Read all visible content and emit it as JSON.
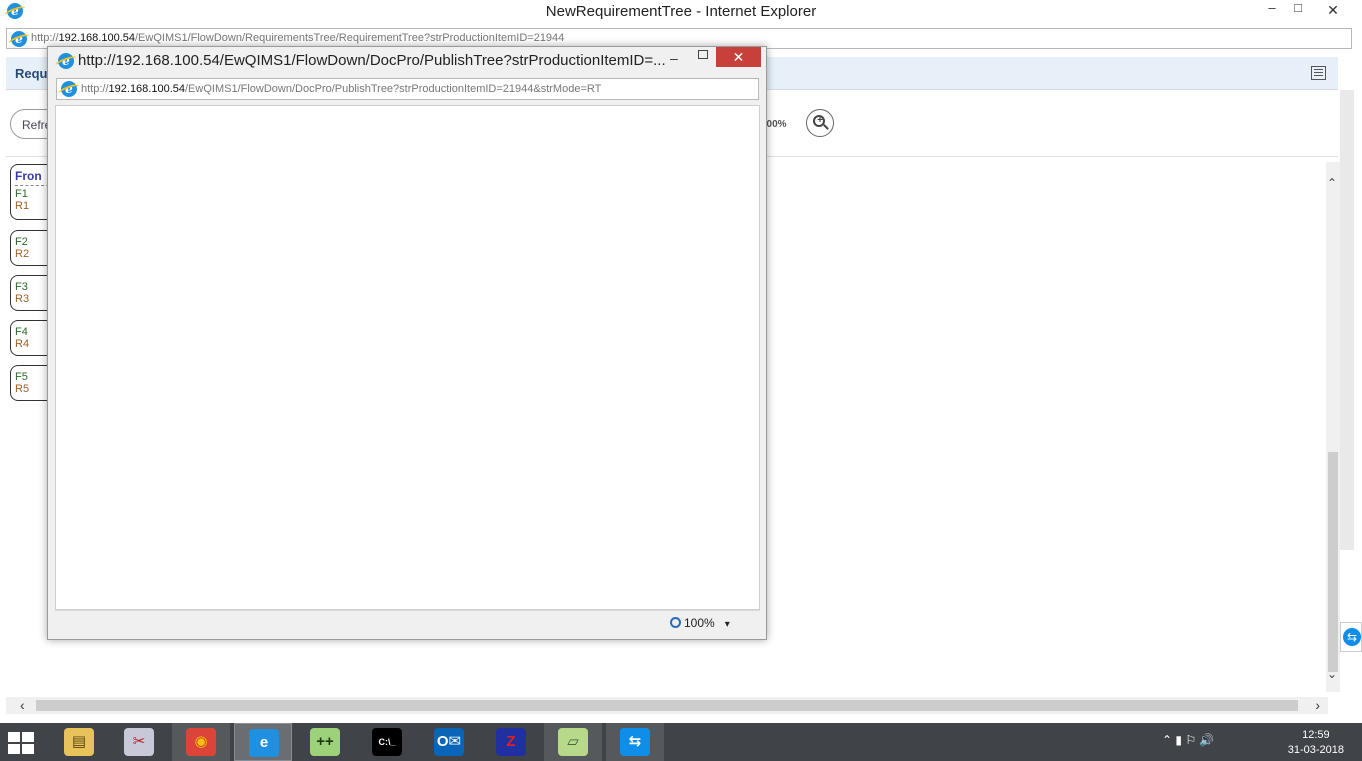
{
  "main_window": {
    "title": "NewRequirementTree - Internet Explorer",
    "minimize": "–",
    "maximize": "□",
    "close": "✕",
    "address": {
      "prefix": "http://",
      "host": "192.168.100.54",
      "path": "/EwQIMS1/FlowDown/RequirementsTree/RequirementTree?strProductionItemID=21944"
    }
  },
  "page": {
    "header_title": "Requ",
    "refresh_label": "Refre",
    "zoom_percent": "100%",
    "tree": {
      "head_label": "Fron",
      "nodes": [
        {
          "f": "F1",
          "r": "R1"
        },
        {
          "f": "F2",
          "r": "R2"
        },
        {
          "f": "F3",
          "r": "R3"
        },
        {
          "f": "F4",
          "r": "R4"
        },
        {
          "f": "F5",
          "r": "R5"
        }
      ]
    }
  },
  "popup": {
    "title": "http://192.168.100.54/EwQIMS1/FlowDown/DocPro/PublishTree?strProductionItemID=...",
    "minimize": "–",
    "close": "✕",
    "address": {
      "prefix": "http://",
      "host": "192.168.100.54",
      "path": "/EwQIMS1/FlowDown/DocPro/PublishTree?strProductionItemID=21944&strMode=RT"
    },
    "zoom": "100%",
    "zoom_arrow": "▾"
  },
  "taskbar": {
    "apps": [
      {
        "name": "file-explorer",
        "glyph": "▤",
        "bg": "#e8c25a",
        "fg": "#5a4410"
      },
      {
        "name": "snipping-tool",
        "glyph": "✂",
        "bg": "#c8c8d8",
        "fg": "#b02020"
      },
      {
        "name": "chrome",
        "glyph": "◉",
        "bg": "#db4437",
        "fg": "#f4c20d"
      },
      {
        "name": "internet-explorer",
        "glyph": "e",
        "bg": "#1f8fe0",
        "fg": "#ffffff"
      },
      {
        "name": "notepad-plus-plus",
        "glyph": "++",
        "bg": "#9ed27a",
        "fg": "#1a3a10"
      },
      {
        "name": "command-prompt",
        "glyph": "C:\\_",
        "bg": "#000000",
        "fg": "#ffffff"
      },
      {
        "name": "outlook",
        "glyph": "O✉",
        "bg": "#0a64b8",
        "fg": "#ffffff"
      },
      {
        "name": "filezilla",
        "glyph": "Z",
        "bg": "#2030a0",
        "fg": "#e02020"
      },
      {
        "name": "sticky-notes",
        "glyph": "▱",
        "bg": "#b8d88a",
        "fg": "#306030"
      },
      {
        "name": "teamviewer",
        "glyph": "⇆",
        "bg": "#0e8ee9",
        "fg": "#ffffff"
      }
    ],
    "tray_icons": "⌃  ▮  ⚐  🔊",
    "time": "12:59",
    "date": "31-03-2018"
  },
  "side_widget": {
    "glyph": "⇆"
  }
}
